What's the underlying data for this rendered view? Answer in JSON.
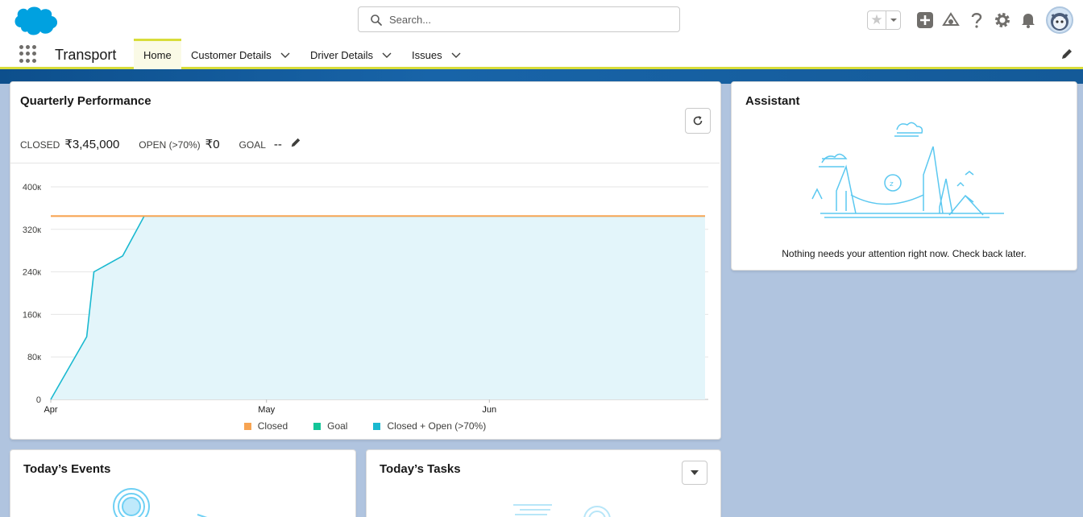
{
  "header": {
    "search_placeholder": "Search...",
    "icons": [
      "favorites-star-icon",
      "favorites-dropdown-icon",
      "global-actions-add-icon",
      "trailhead-icon",
      "help-icon",
      "setup-gear-icon",
      "notifications-bell-icon",
      "user-avatar"
    ]
  },
  "nav": {
    "app_name": "Transport",
    "items": [
      {
        "label": "Home",
        "active": true
      },
      {
        "label": "Customer Details"
      },
      {
        "label": "Driver Details"
      },
      {
        "label": "Issues"
      }
    ]
  },
  "quarterly": {
    "title": "Quarterly Performance",
    "closed_label": "CLOSED",
    "closed_value": "₹3,45,000",
    "open_label": "OPEN (>70%)",
    "open_value": "₹0",
    "goal_label": "GOAL",
    "goal_value": "--"
  },
  "chart_data": {
    "type": "area",
    "x_ticks": [
      "Apr",
      "May",
      "Jun"
    ],
    "y_ticks": [
      "0",
      "80к",
      "160к",
      "240к",
      "320к",
      "400к"
    ],
    "ylim": [
      0,
      400000
    ],
    "x_domain_days": [
      0,
      91
    ],
    "x_tick_days": [
      0,
      30,
      61
    ],
    "series": [
      {
        "name": "Closed",
        "color": "#f7a452",
        "type": "line",
        "points": [
          [
            0,
            345000
          ],
          [
            91,
            345000
          ]
        ]
      },
      {
        "name": "Goal",
        "color": "#13c598",
        "type": "line",
        "points": []
      },
      {
        "name": "Closed + Open (>70%)",
        "color": "#1ab9d0",
        "type": "area",
        "points": [
          [
            0,
            0
          ],
          [
            5,
            118000
          ],
          [
            6,
            240000
          ],
          [
            10,
            270000
          ],
          [
            13,
            345000
          ],
          [
            91,
            345000
          ]
        ]
      }
    ],
    "legend_position": "bottom",
    "grid": true
  },
  "assistant": {
    "title": "Assistant",
    "message": "Nothing needs your attention right now. Check back later."
  },
  "events": {
    "title": "Today’s Events"
  },
  "tasks": {
    "title": "Today’s Tasks"
  },
  "colors": {
    "accent": "#0176d3",
    "nav_underline": "#d8dd3a",
    "chart_fill": "#e3f5fa"
  }
}
